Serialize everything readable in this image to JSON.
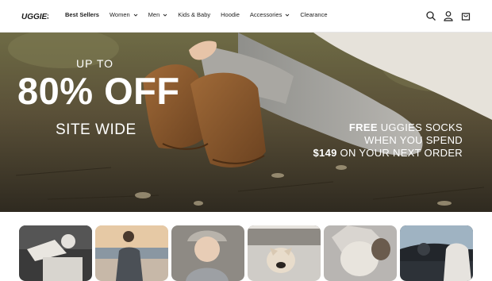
{
  "header": {
    "logo_text": "UGGIES",
    "nav": [
      {
        "label": "Best Sellers",
        "dropdown": false
      },
      {
        "label": "Women",
        "dropdown": true
      },
      {
        "label": "Men",
        "dropdown": true
      },
      {
        "label": "Kids & Baby",
        "dropdown": false
      },
      {
        "label": "Hoodie",
        "dropdown": false
      },
      {
        "label": "Accessories",
        "dropdown": true
      },
      {
        "label": "Clearance",
        "dropdown": false
      }
    ],
    "icons": [
      "search-icon",
      "account-icon",
      "cart-icon"
    ]
  },
  "hero": {
    "up_to": "UP TO",
    "discount": "80% OFF",
    "site_wide": "SITE WIDE",
    "promo_line1_bold": "FREE",
    "promo_line1_rest": " UGGIES SOCKS",
    "promo_line2": "WHEN YOU SPEND",
    "promo_line3_bold": "$149",
    "promo_line3_rest": " ON YOUR NEXT ORDER"
  },
  "tiles": [
    "tile-car-lounge",
    "tile-beach-man",
    "tile-baby",
    "tile-dog",
    "tile-hat",
    "tile-driver"
  ],
  "colors": {
    "text": "#222222",
    "white": "#ffffff",
    "boot": "#8a5a2e"
  }
}
